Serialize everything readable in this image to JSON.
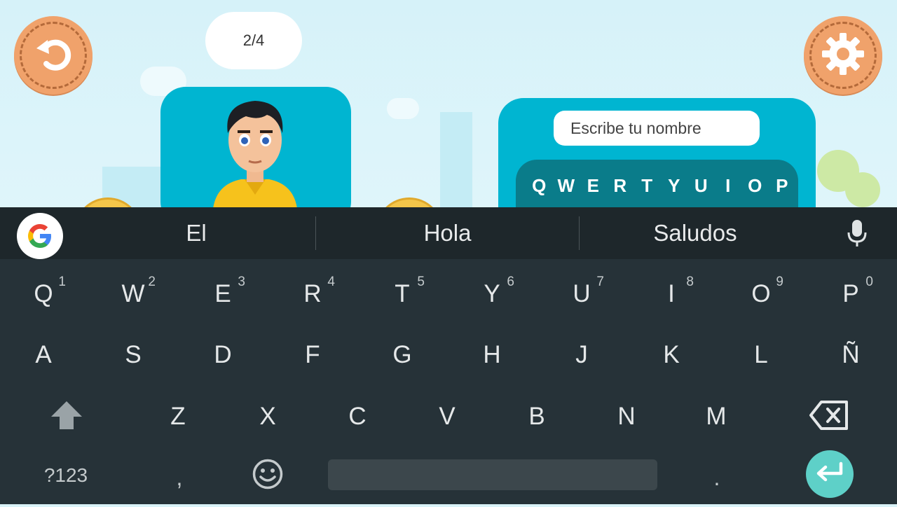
{
  "game": {
    "counter": "2/4",
    "name_placeholder": "Escribe tu nombre",
    "keyboard_row": [
      "Q",
      "W",
      "E",
      "R",
      "T",
      "Y",
      "U",
      "I",
      "O",
      "P"
    ],
    "colors": {
      "card": "#00b5d1",
      "round_button": "#f0a26b",
      "sky": "#d6f2f9"
    },
    "icons": {
      "back": "undo-icon",
      "settings": "gear-icon",
      "character": "avatar"
    }
  },
  "suggestions": [
    "El",
    "Hola",
    "Saludos"
  ],
  "keyboard": {
    "row1": [
      {
        "label": "Q",
        "hint": "1"
      },
      {
        "label": "W",
        "hint": "2"
      },
      {
        "label": "E",
        "hint": "3"
      },
      {
        "label": "R",
        "hint": "4"
      },
      {
        "label": "T",
        "hint": "5"
      },
      {
        "label": "Y",
        "hint": "6"
      },
      {
        "label": "U",
        "hint": "7"
      },
      {
        "label": "I",
        "hint": "8"
      },
      {
        "label": "O",
        "hint": "9"
      },
      {
        "label": "P",
        "hint": "0"
      }
    ],
    "row2": [
      "A",
      "S",
      "D",
      "F",
      "G",
      "H",
      "J",
      "K",
      "L",
      "Ñ"
    ],
    "row3": [
      "Z",
      "X",
      "C",
      "V",
      "B",
      "N",
      "M"
    ],
    "symbols_label": "?123",
    "comma_label": ",",
    "period_label": ".",
    "colors": {
      "background": "#263238",
      "suggest_bar": "#1e272b",
      "enter": "#5ed0c8"
    }
  }
}
